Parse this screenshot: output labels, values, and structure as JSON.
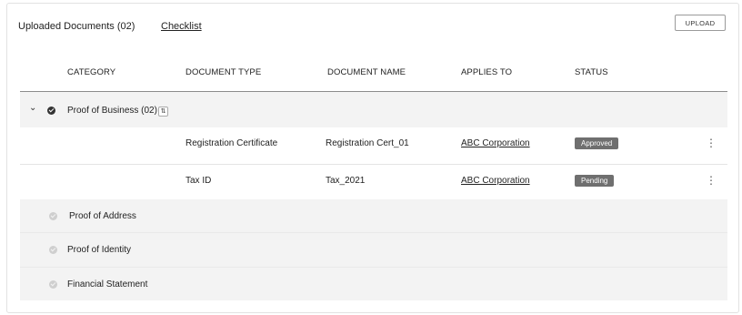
{
  "header": {
    "title": "Uploaded Documents (02)",
    "checklist_link": "Checklist",
    "upload_button": "UPLOAD"
  },
  "columns": [
    "CATEGORY",
    "DOCUMENT TYPE",
    "DOCUMENT NAME",
    "APPLIES TO",
    "STATUS"
  ],
  "group": {
    "label": "Proof of Business (02)",
    "expand_icon": "chevron-down-icon",
    "reorder_icon": "reorder-icon",
    "documents": [
      {
        "type": "Registration Certificate",
        "name": "Registration Cert_01",
        "applies_to": "ABC Corporation",
        "status": "Approved",
        "menu_icon": "more-vertical-icon"
      },
      {
        "type": "Tax ID",
        "name": "Tax_2021",
        "applies_to": "ABC Corporation",
        "status": "Pending",
        "menu_icon": "more-vertical-icon"
      }
    ]
  },
  "other_categories": [
    {
      "label": "Proof of Address"
    },
    {
      "label": "Proof of Identity"
    },
    {
      "label": "Financial Statement"
    }
  ],
  "colors": {
    "badge": "#6f6f6f",
    "row_grey": "#f3f3f3",
    "rule": "#8c8c8c"
  }
}
